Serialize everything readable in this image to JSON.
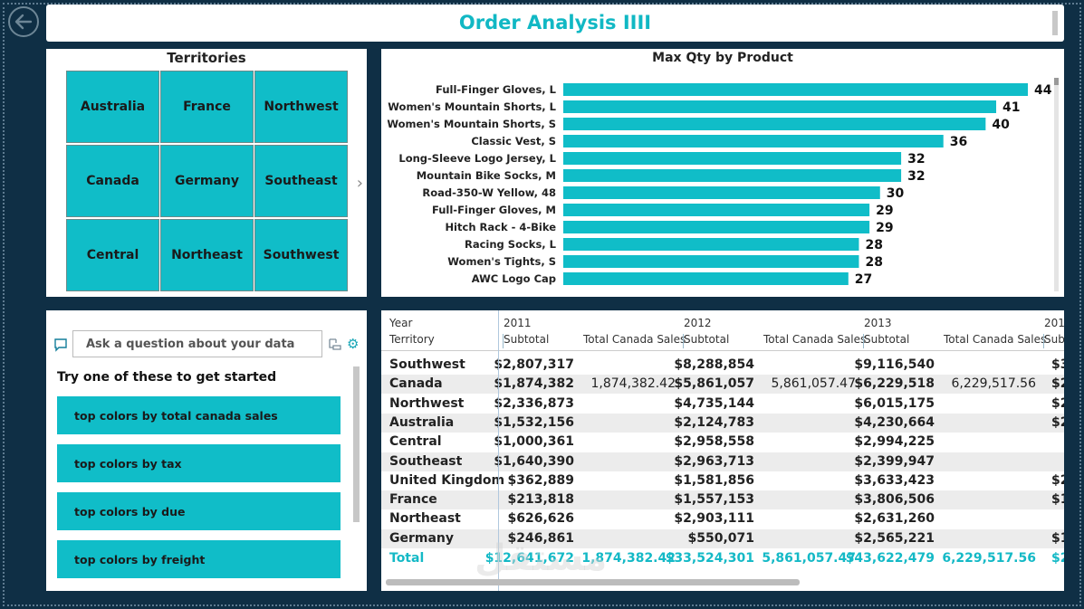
{
  "title": "Order Analysis IIII",
  "territories": {
    "title": "Territories",
    "items": [
      "Australia",
      "France",
      "Northwest",
      "Canada",
      "Germany",
      "Southeast",
      "Central",
      "Northeast",
      "Southwest"
    ]
  },
  "chart_data": {
    "type": "bar",
    "orientation": "horizontal",
    "title": "Max Qty by Product",
    "categories": [
      "Full-Finger Gloves, L",
      "Women's Mountain Shorts, L",
      "Women's Mountain Shorts, S",
      "Classic Vest, S",
      "Long-Sleeve Logo Jersey, L",
      "Mountain Bike Socks, M",
      "Road-350-W Yellow, 48",
      "Full-Finger Gloves, M",
      "Hitch Rack - 4-Bike",
      "Racing Socks, L",
      "Women's Tights, S",
      "AWC Logo Cap"
    ],
    "values": [
      44,
      41,
      40,
      36,
      32,
      32,
      30,
      29,
      29,
      28,
      28,
      27
    ],
    "xlim": [
      0,
      44
    ],
    "color": "#10bdc8",
    "data_labels": true
  },
  "qa": {
    "placeholder": "Ask a question about your data",
    "hint": "Try one of these to get started",
    "suggestions": [
      "top colors by total canada sales",
      "top colors by tax",
      "top colors by due",
      "top colors by freight"
    ]
  },
  "table": {
    "row_header_top": "Year",
    "row_header_bottom": "Territory",
    "years": [
      "2011",
      "2012",
      "2013",
      "201"
    ],
    "col_subtotal": "Subtotal",
    "col_canada": "Total Canada Sales",
    "col_cut": "Sub",
    "rows": [
      {
        "territory": "Southwest",
        "s2011": "$2,807,317",
        "c2011": "",
        "s2012": "$8,288,854",
        "c2012": "",
        "s2013": "$9,116,540",
        "c2013": "",
        "cut": "$3"
      },
      {
        "territory": "Canada",
        "s2011": "$1,874,382",
        "c2011": "1,874,382.42",
        "s2012": "$5,861,057",
        "c2012": "5,861,057.47",
        "s2013": "$6,229,518",
        "c2013": "6,229,517.56",
        "cut": "$2"
      },
      {
        "territory": "Northwest",
        "s2011": "$2,336,873",
        "c2011": "",
        "s2012": "$4,735,144",
        "c2012": "",
        "s2013": "$6,015,175",
        "c2013": "",
        "cut": "$2"
      },
      {
        "territory": "Australia",
        "s2011": "$1,532,156",
        "c2011": "",
        "s2012": "$2,124,783",
        "c2012": "",
        "s2013": "$4,230,664",
        "c2013": "",
        "cut": "$2"
      },
      {
        "territory": "Central",
        "s2011": "$1,000,361",
        "c2011": "",
        "s2012": "$2,958,558",
        "c2012": "",
        "s2013": "$2,994,225",
        "c2013": "",
        "cut": ""
      },
      {
        "territory": "Southeast",
        "s2011": "$1,640,390",
        "c2011": "",
        "s2012": "$2,963,713",
        "c2012": "",
        "s2013": "$2,399,947",
        "c2013": "",
        "cut": ""
      },
      {
        "territory": "United Kingdom",
        "s2011": "$362,889",
        "c2011": "",
        "s2012": "$1,581,856",
        "c2012": "",
        "s2013": "$3,633,423",
        "c2013": "",
        "cut": "$2"
      },
      {
        "territory": "France",
        "s2011": "$213,818",
        "c2011": "",
        "s2012": "$1,557,153",
        "c2012": "",
        "s2013": "$3,806,506",
        "c2013": "",
        "cut": "$1"
      },
      {
        "territory": "Northeast",
        "s2011": "$626,626",
        "c2011": "",
        "s2012": "$2,903,111",
        "c2012": "",
        "s2013": "$2,631,260",
        "c2013": "",
        "cut": ""
      },
      {
        "territory": "Germany",
        "s2011": "$246,861",
        "c2011": "",
        "s2012": "$550,071",
        "c2012": "",
        "s2013": "$2,565,221",
        "c2013": "",
        "cut": "$1"
      }
    ],
    "total": {
      "territory": "Total",
      "s2011": "$12,641,672",
      "c2011": "1,874,382.42",
      "s2012": "$33,524,301",
      "c2012": "5,861,057.47",
      "s2013": "$43,622,479",
      "c2013": "6,229,517.56",
      "cut": "$2("
    }
  },
  "watermark": "مستقل"
}
